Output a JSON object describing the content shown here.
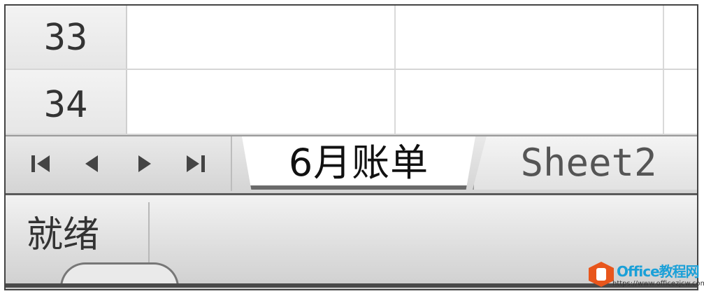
{
  "rows": [
    {
      "header": "33"
    },
    {
      "header": "34"
    }
  ],
  "nav": {
    "first_icon": "first-sheet-icon",
    "prev_icon": "prev-sheet-icon",
    "next_icon": "next-sheet-icon",
    "last_icon": "last-sheet-icon"
  },
  "tabs": [
    {
      "label": "6月账单",
      "active": true
    },
    {
      "label": "Sheet2",
      "active": false
    }
  ],
  "status": {
    "text": "就绪"
  },
  "watermark": {
    "title": "Office教程网",
    "url": "https://www.officezjcw.com"
  },
  "colors": {
    "watermark_orange": "#e8561c",
    "watermark_blue": "#1aa0d8"
  }
}
